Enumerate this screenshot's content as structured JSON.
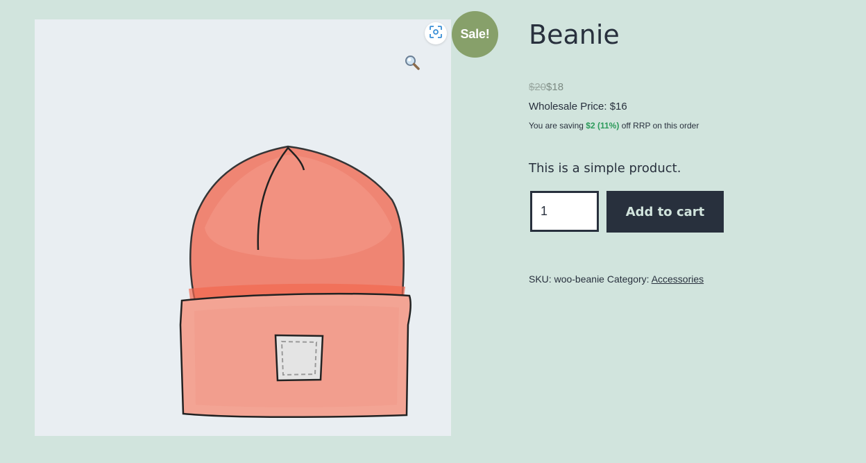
{
  "badge": {
    "sale_label": "Sale!",
    "color": "#87a06a"
  },
  "icons": {
    "zoom": "magnifier-icon",
    "scan": "scan-icon"
  },
  "product": {
    "title": "Beanie",
    "price": {
      "regular": "$20",
      "sale": "$18"
    },
    "wholesale": {
      "label": "Wholesale Price:",
      "value": "$16"
    },
    "saving": {
      "prefix": "You are saving",
      "amount": "$2",
      "percent_open": "(",
      "percent": "11%",
      "percent_close": ")",
      "suffix": "off RRP on this order"
    },
    "short_description": "This is a simple product.",
    "quantity": "1",
    "add_to_cart_label": "Add to cart",
    "sku_label": "SKU:",
    "sku_value": "woo-beanie",
    "category_label": "Category:",
    "category_value": "Accessories"
  },
  "colors": {
    "background": "#d1e4dd",
    "text": "#28303d",
    "button": "#28303d",
    "saving_green": "#2c9a5a"
  }
}
